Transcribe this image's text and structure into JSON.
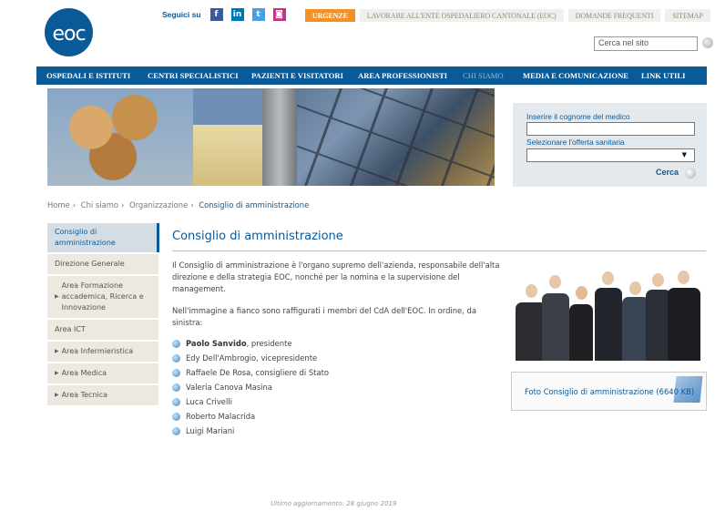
{
  "header": {
    "logo_text": "eoc",
    "follow_label": "Seguici su",
    "social": [
      {
        "name": "facebook",
        "glyph": "f",
        "color": "#3b5998"
      },
      {
        "name": "linkedin",
        "glyph": "in",
        "color": "#0077b5"
      },
      {
        "name": "twitter",
        "glyph": "t",
        "color": "#4aa0e0"
      },
      {
        "name": "instagram",
        "glyph": "◙",
        "color": "#c13584"
      }
    ],
    "top_links": [
      "URGENZE",
      "LAVORARE ALL'ENTE OSPEDALIERO CANTONALE (EOC)",
      "DOMANDE FREQUENTI",
      "SITEMAP"
    ],
    "search_placeholder": "Cerca nel sito"
  },
  "main_nav": [
    "OSPEDALI E ISTITUTI",
    "CENTRI SPECIALISTICI",
    "PAZIENTI E VISITATORI",
    "AREA PROFESSIONISTI",
    "CHI SIAMO",
    "MEDIA E COMUNICAZIONE",
    "LINK UTILI"
  ],
  "doctor_search": {
    "surname_label": "Inserire il cognome del medico",
    "offer_label": "Selezionare l'offerta sanitaria",
    "button_label": "Cerca"
  },
  "breadcrumb": [
    "Home",
    "Chi siamo",
    "Organizzazione",
    "Consiglio di amministrazione"
  ],
  "side_menu": [
    {
      "label": "Consiglio di amministrazione",
      "active": true,
      "arrow": false
    },
    {
      "label": "Direzione Generale",
      "active": false,
      "arrow": false
    },
    {
      "label": "Area Formazione accademica, Ricerca e Innovazione",
      "active": false,
      "arrow": true
    },
    {
      "label": "Area ICT",
      "active": false,
      "arrow": false
    },
    {
      "label": "Area Infermieristica",
      "active": false,
      "arrow": true
    },
    {
      "label": "Area Medica",
      "active": false,
      "arrow": true
    },
    {
      "label": "Area Tecnica",
      "active": false,
      "arrow": true
    }
  ],
  "content": {
    "title": "Consiglio di amministrazione",
    "intro": "Il Consiglio di amministrazione è l'organo supremo dell'azienda, responsabile dell'alta direzione e della strategia EOC, nonché per la nomina e la supervisione del management.",
    "list_intro": "Nell'immagine a fianco sono raffigurati i membri del CdA dell'EOC. In ordine, da sinistra:",
    "members": [
      {
        "name": "Paolo Sanvido",
        "role": ", presidente",
        "bold": true
      },
      {
        "name": "Edy Dell'Ambrogio, vicepresidente",
        "role": "",
        "bold": false
      },
      {
        "name": "Raffaele De Rosa, consigliere di Stato",
        "role": "",
        "bold": false
      },
      {
        "name": "Valeria Canova Masina",
        "role": "",
        "bold": false
      },
      {
        "name": "Luca Crivelli",
        "role": "",
        "bold": false
      },
      {
        "name": "Roberto Malacrida",
        "role": "",
        "bold": false
      },
      {
        "name": "Luigi Mariani",
        "role": "",
        "bold": false
      }
    ],
    "photo_caption": "Foto Consiglio di amministrazione (6640 KB)",
    "updated": "Ultimo aggiornamento: 28 giugno 2019"
  },
  "colors": {
    "brand": "#0a5a98",
    "urgent": "#f39125"
  }
}
